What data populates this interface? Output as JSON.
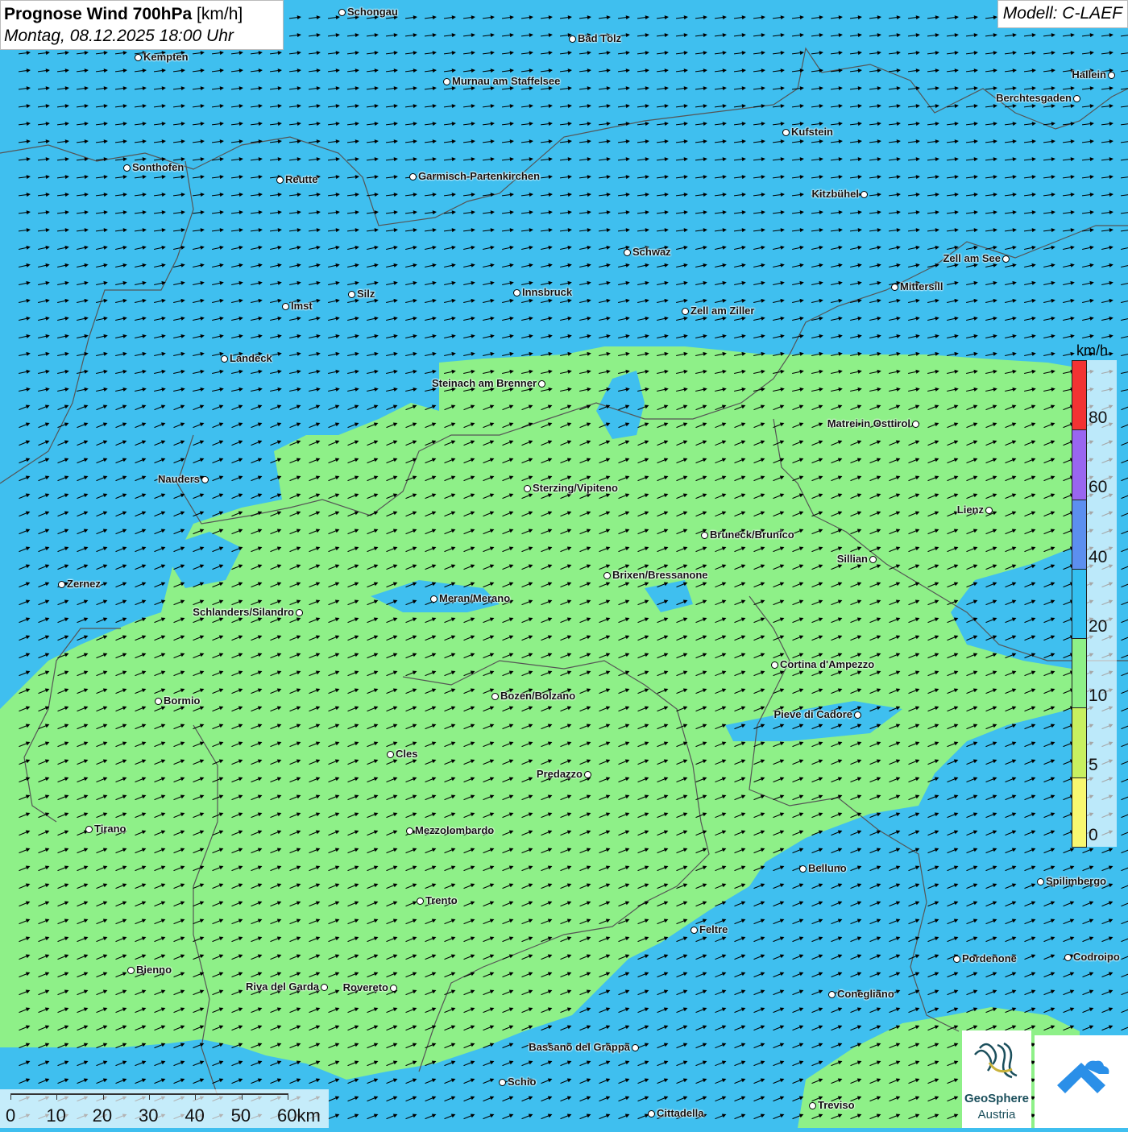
{
  "title": {
    "main": "Prognose Wind 700hPa",
    "unit": "[km/h]",
    "datetime": "Montag, 08.12.2025 18:00 Uhr"
  },
  "model": "Modell: C-LAEF",
  "legend": {
    "unit": "km/h",
    "levels": [
      {
        "label": "80",
        "color": "#f23333"
      },
      {
        "label": "60",
        "color": "#9966f0"
      },
      {
        "label": "40",
        "color": "#5c8fef"
      },
      {
        "label": "20",
        "color": "#33bff0"
      },
      {
        "label": "10",
        "color": "#8ef088"
      },
      {
        "label": "5",
        "color": "#c8f060"
      },
      {
        "label": "0",
        "color": "#f8f870"
      }
    ]
  },
  "colors": {
    "wind_10_20": "#3fbfef",
    "wind_5_10": "#8ef088",
    "borders": "#555555",
    "arrows": "#000000"
  },
  "cities": [
    {
      "name": "Schongau"
    },
    {
      "name": "Bad Tölz"
    },
    {
      "name": "Kempten"
    },
    {
      "name": "Murnau am Staffelsee"
    },
    {
      "name": "Hallein"
    },
    {
      "name": "Berchtesgaden"
    },
    {
      "name": "Kufstein"
    },
    {
      "name": "Sonthofen"
    },
    {
      "name": "Reutte"
    },
    {
      "name": "Garmisch-Partenkirchen"
    },
    {
      "name": "Kitzbühel"
    },
    {
      "name": "Schwaz"
    },
    {
      "name": "Zell am See"
    },
    {
      "name": "Mittersill"
    },
    {
      "name": "Innsbruck"
    },
    {
      "name": "Silz"
    },
    {
      "name": "Imst"
    },
    {
      "name": "Zell am Ziller"
    },
    {
      "name": "Landeck"
    },
    {
      "name": "Steinach am Brenner"
    },
    {
      "name": "Matrei in Osttirol"
    },
    {
      "name": "Nauders"
    },
    {
      "name": "Sterzing/Vipiteno"
    },
    {
      "name": "Lienz"
    },
    {
      "name": "Bruneck/Brunico"
    },
    {
      "name": "Sillian"
    },
    {
      "name": "Brixen/Bressanone"
    },
    {
      "name": "Zernez"
    },
    {
      "name": "Meran/Merano"
    },
    {
      "name": "Schlanders/Silandro"
    },
    {
      "name": "Cortina d'Ampezzo"
    },
    {
      "name": "Bozen/Bolzano"
    },
    {
      "name": "Bormio"
    },
    {
      "name": "Pieve di Cadore"
    },
    {
      "name": "Cles"
    },
    {
      "name": "Predazzo"
    },
    {
      "name": "Tirano"
    },
    {
      "name": "Mezzolombardo"
    },
    {
      "name": "Belluno"
    },
    {
      "name": "Spilimbergo"
    },
    {
      "name": "Trento"
    },
    {
      "name": "Feltre"
    },
    {
      "name": "Pordenone"
    },
    {
      "name": "Codroipo"
    },
    {
      "name": "Bienno"
    },
    {
      "name": "Riva del Garda"
    },
    {
      "name": "Rovereto"
    },
    {
      "name": "Conegliano"
    },
    {
      "name": "Bassano del Grappa"
    },
    {
      "name": "Schio"
    },
    {
      "name": "Treviso"
    },
    {
      "name": "Cittadella"
    }
  ],
  "scale_bar": {
    "labels": [
      "0",
      "10",
      "20",
      "30",
      "40",
      "50",
      "60km"
    ]
  },
  "logos": {
    "geosphere_name": "GeoSphere",
    "geosphere_sub": "Austria"
  }
}
